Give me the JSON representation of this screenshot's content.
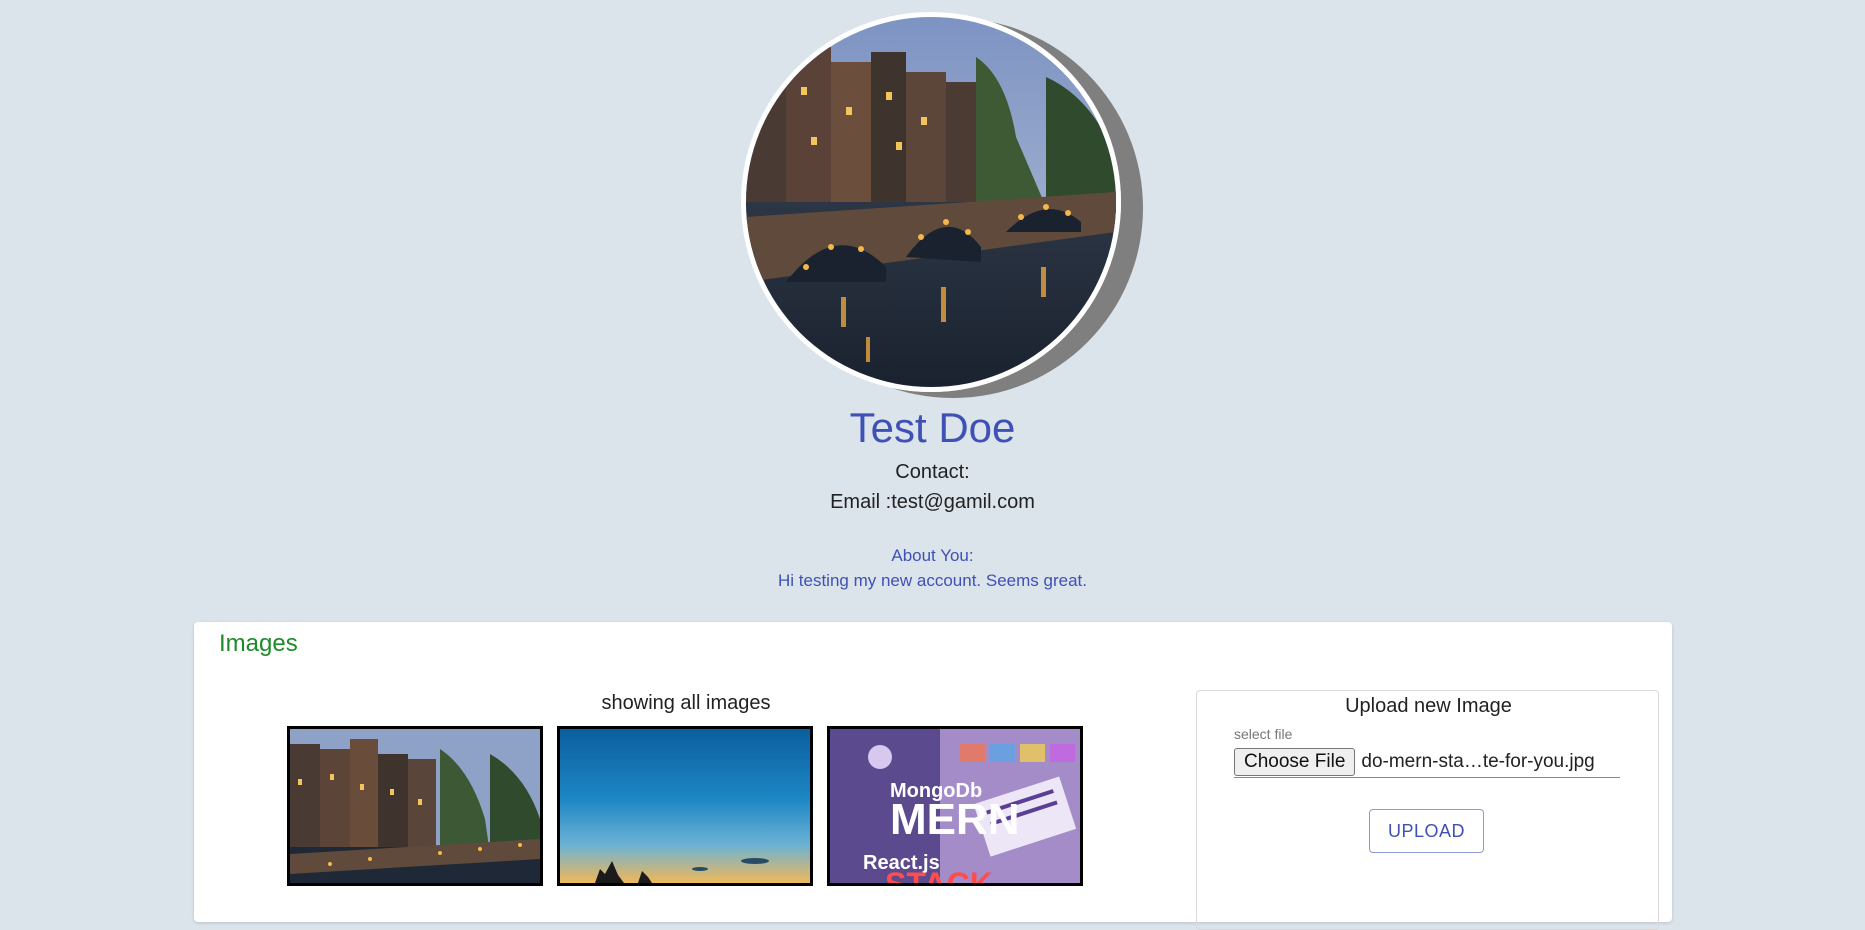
{
  "profile": {
    "name": "Test Doe",
    "contact_label": "Contact:",
    "email_line": "Email :test@gamil.com",
    "about_label": "About You:",
    "about_text": "Hi testing my new account. Seems great."
  },
  "images_section": {
    "title": "Images",
    "caption": "showing all images",
    "thumbnails": [
      {
        "name": "canal-bridge-night-image"
      },
      {
        "name": "sunset-sky-image"
      },
      {
        "name": "mern-stack-banner-image",
        "text_line1": "MongoDb",
        "text_line2": "MERN",
        "text_line3": "React.js",
        "text_line4": "STACK"
      }
    ]
  },
  "upload": {
    "title": "Upload new Image",
    "select_label": "select file",
    "choose_button": "Choose File",
    "file_name": "do-mern-sta…te-for-you.jpg",
    "upload_button": "UPLOAD"
  },
  "colors": {
    "background": "#dbe3eb",
    "accent": "#3f51b5",
    "section_title": "#1e8a2a"
  }
}
